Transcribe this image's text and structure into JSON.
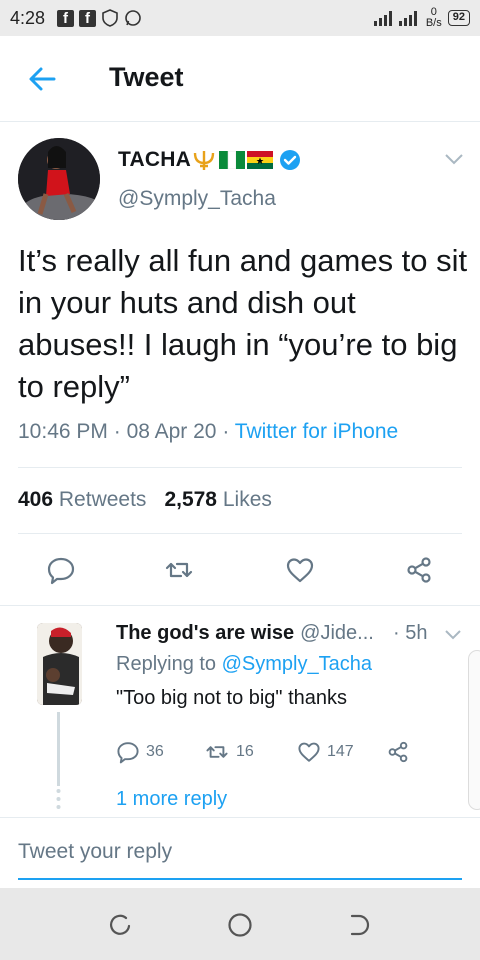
{
  "status_bar": {
    "time": "4:28",
    "network_speed_value": "0",
    "network_speed_unit": "B/s",
    "battery": "92"
  },
  "header": {
    "title": "Tweet"
  },
  "main_tweet": {
    "display_name": "TACHA",
    "handle": "@Symply_Tacha",
    "text": "It’s really all fun and games to sit in your huts and dish out abuses!! I laugh in “you’re to big to reply”",
    "time": "10:46 PM",
    "date": "08 Apr 20",
    "separator": "·",
    "source": "Twitter for iPhone",
    "retweets_count": "406",
    "retweets_label": "Retweets",
    "likes_count": "2,578",
    "likes_label": "Likes"
  },
  "reply": {
    "display_name": "The god's are wise",
    "handle": "@Jide...",
    "time": "· 5h",
    "replying_prefix": "Replying to",
    "replying_to": "@Symply_Tacha",
    "text": "\"Too big not to big\" thanks",
    "reply_count": "36",
    "retweet_count": "16",
    "like_count": "147",
    "more_replies": "1 more reply"
  },
  "compose": {
    "placeholder": "Tweet your reply"
  },
  "colors": {
    "accent": "#1da1f2",
    "secondary_text": "#657786",
    "divider": "#e6ecf0"
  }
}
